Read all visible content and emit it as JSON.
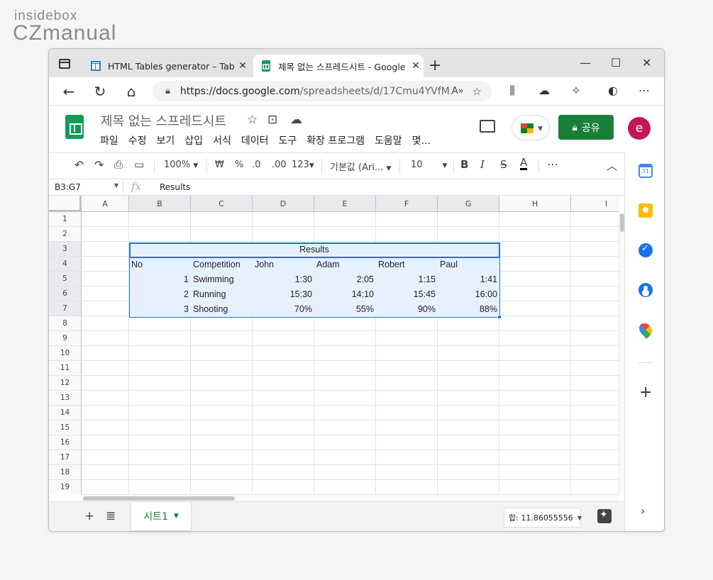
{
  "watermark": {
    "line1": "insidebox",
    "line2": "CZmanual"
  },
  "browser": {
    "tabs": [
      {
        "title": "HTML Tables generator – TablesG",
        "favicon": "tablesgenerator-icon"
      },
      {
        "title": "제목 없는 스프레드시트 - Google",
        "favicon": "sheets-icon"
      }
    ],
    "new_tab": "+",
    "url_host": "https://docs.google.com",
    "url_path": "/spreadsheets/d/17Cmu4YVfM..."
  },
  "sheets": {
    "title": "제목 없는 스프레드시트",
    "menu": [
      "파일",
      "수정",
      "보기",
      "삽입",
      "서식",
      "데이터",
      "도구",
      "확장 프로그램",
      "도움말",
      "몇..."
    ],
    "share_label": "공유",
    "avatar_letter": "e",
    "toolbar": {
      "zoom": "100%",
      "currency": "₩",
      "percent": "%",
      "dec_less": ".0",
      "dec_more": ".00",
      "format": "123",
      "font": "기본값 (Ari...",
      "font_size": "10",
      "bold": "B",
      "italic": "I",
      "strike": "S",
      "text_color": "A",
      "more": "⋯"
    },
    "name_box": "B3:G7",
    "formula_value": "Results",
    "columns": [
      "A",
      "B",
      "C",
      "D",
      "E",
      "F",
      "G",
      "H",
      "I"
    ],
    "rows": [
      "1",
      "2",
      "3",
      "4",
      "5",
      "6",
      "7",
      "8",
      "9",
      "10",
      "11",
      "12",
      "13",
      "14",
      "15",
      "16",
      "17",
      "18",
      "19"
    ],
    "table": {
      "title": "Results",
      "header": [
        "No",
        "Competition",
        "John",
        "Adam",
        "Robert",
        "Paul"
      ],
      "body": [
        [
          "1",
          "Swimming",
          "1:30",
          "2:05",
          "1:15",
          "1:41"
        ],
        [
          "2",
          "Running",
          "15:30",
          "14:10",
          "15:45",
          "16:00"
        ],
        [
          "3",
          "Shooting",
          "70%",
          "55%",
          "90%",
          "88%"
        ]
      ]
    },
    "sheet_tab": "시트1",
    "sum_label": "합: 11.86055556"
  },
  "colors": {
    "accent": "#1a73e8",
    "share_green": "#188038",
    "selection_fill": "#e7f0fd",
    "avatar": "#c2185b"
  }
}
